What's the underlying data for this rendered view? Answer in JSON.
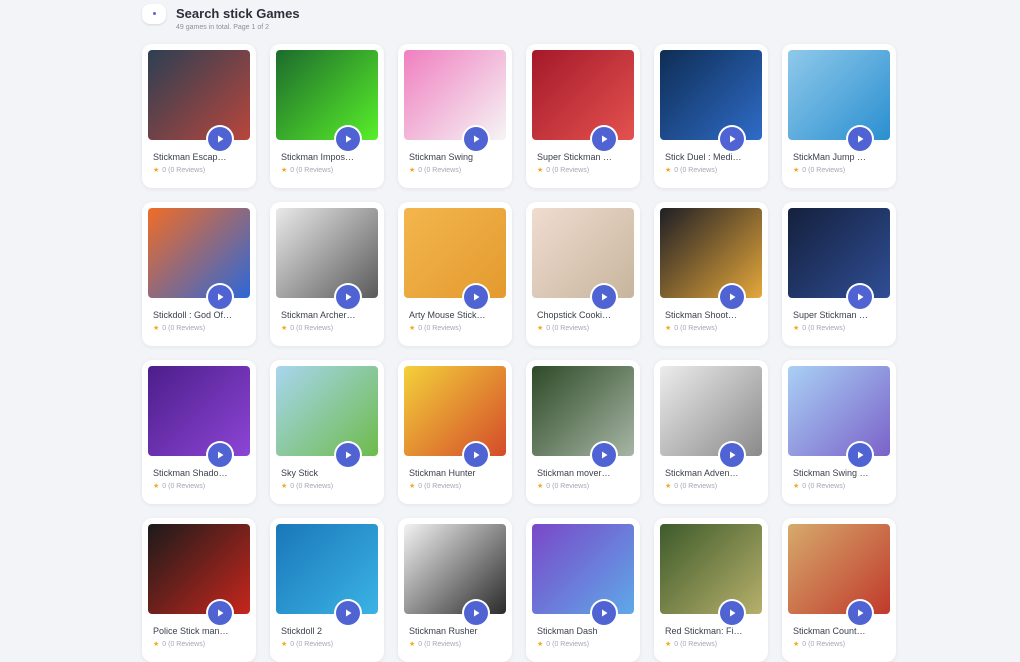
{
  "header": {
    "title": "Search stick Games",
    "subtitle": "49 games in total. Page 1 of 2"
  },
  "rating_star_color": "#f4a52b",
  "play_button_color": "#4f63d2",
  "games": [
    {
      "name": "Stickman Escap…",
      "rating": "0 (0 Reviews)",
      "bg": [
        "#2c3f53",
        "#b8463c"
      ]
    },
    {
      "name": "Stickman Impos…",
      "rating": "0 (0 Reviews)",
      "bg": [
        "#1d6b2c",
        "#58ef2a"
      ]
    },
    {
      "name": "Stickman Swing",
      "rating": "0 (0 Reviews)",
      "bg": [
        "#f07fc0",
        "#f5f5f5"
      ]
    },
    {
      "name": "Super Stickman …",
      "rating": "0 (0 Reviews)",
      "bg": [
        "#a4192a",
        "#e4524f"
      ]
    },
    {
      "name": "Stick Duel : Medi…",
      "rating": "0 (0 Reviews)",
      "bg": [
        "#0e2d55",
        "#2f6cc7"
      ]
    },
    {
      "name": "StickMan Jump …",
      "rating": "0 (0 Reviews)",
      "bg": [
        "#8fc9ea",
        "#2a8fd0"
      ]
    },
    {
      "name": "Stickdoll : God Of…",
      "rating": "0 (0 Reviews)",
      "bg": [
        "#f06c26",
        "#2c68d8"
      ]
    },
    {
      "name": "Stickman Archer…",
      "rating": "0 (0 Reviews)",
      "bg": [
        "#e9e9e9",
        "#5a5a5a"
      ]
    },
    {
      "name": "Arty Mouse Stick…",
      "rating": "0 (0 Reviews)",
      "bg": [
        "#f3b64d",
        "#e39a2e"
      ]
    },
    {
      "name": "Chopstick Cooki…",
      "rating": "0 (0 Reviews)",
      "bg": [
        "#f0dcd0",
        "#c6b59d"
      ]
    },
    {
      "name": "Stickman Shoot…",
      "rating": "0 (0 Reviews)",
      "bg": [
        "#1f1f25",
        "#e5a73a"
      ]
    },
    {
      "name": "Super Stickman …",
      "rating": "0 (0 Reviews)",
      "bg": [
        "#14203d",
        "#2f4e94"
      ]
    },
    {
      "name": "Stickman Shado…",
      "rating": "0 (0 Reviews)",
      "bg": [
        "#4c1e8a",
        "#8d45d6"
      ]
    },
    {
      "name": "Sky Stick",
      "rating": "0 (0 Reviews)",
      "bg": [
        "#a8d6ef",
        "#6dbb4b"
      ]
    },
    {
      "name": "Stickman Hunter",
      "rating": "0 (0 Reviews)",
      "bg": [
        "#f3d13a",
        "#d44b2a"
      ]
    },
    {
      "name": "Stickman mover…",
      "rating": "0 (0 Reviews)",
      "bg": [
        "#2d4a26",
        "#a7b6a5"
      ]
    },
    {
      "name": "Stickman Adven…",
      "rating": "0 (0 Reviews)",
      "bg": [
        "#ececec",
        "#8a8a8a"
      ]
    },
    {
      "name": "Stickman Swing …",
      "rating": "0 (0 Reviews)",
      "bg": [
        "#a9d0f5",
        "#7b62c9"
      ]
    },
    {
      "name": "Police Stick man…",
      "rating": "0 (0 Reviews)",
      "bg": [
        "#1b1b1b",
        "#c7261c"
      ]
    },
    {
      "name": "Stickdoll 2",
      "rating": "0 (0 Reviews)",
      "bg": [
        "#1a77b9",
        "#3bb3e5"
      ]
    },
    {
      "name": "Stickman Rusher",
      "rating": "0 (0 Reviews)",
      "bg": [
        "#f2f2f2",
        "#2a2a2a"
      ]
    },
    {
      "name": "Stickman Dash",
      "rating": "0 (0 Reviews)",
      "bg": [
        "#7a47c9",
        "#5fa9e8"
      ]
    },
    {
      "name": "Red Stickman: Fi…",
      "rating": "0 (0 Reviews)",
      "bg": [
        "#3d5b2b",
        "#b7b06b"
      ]
    },
    {
      "name": "Stickman Count…",
      "rating": "0 (0 Reviews)",
      "bg": [
        "#d6aa6c",
        "#c0392b"
      ]
    }
  ]
}
